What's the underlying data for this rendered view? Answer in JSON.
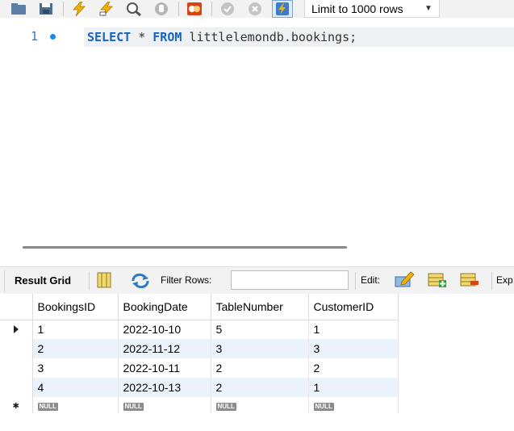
{
  "toolbar": {
    "icons": [
      "open-folder-icon",
      "save-icon",
      "execute-icon",
      "execute-current-icon",
      "explain-icon",
      "stop-icon",
      "toggle-error-icon",
      "commit-icon",
      "rollback-icon",
      "autocommit-icon"
    ],
    "limit_select": "Limit to 1000 rows"
  },
  "editor": {
    "line_number": "1",
    "code": {
      "select_kw": "SELECT",
      "star": " * ",
      "from_kw": "FROM",
      "rest": " littlelemondb.bookings;"
    }
  },
  "result": {
    "tab_label": "Result Grid",
    "filter_label": "Filter Rows:",
    "filter_value": "",
    "edit_label": "Edit:",
    "export_label": "Exp"
  },
  "grid": {
    "columns": [
      "BookingsID",
      "BookingDate",
      "TableNumber",
      "CustomerID"
    ],
    "rows": [
      [
        "1",
        "2022-10-10",
        "5",
        "1"
      ],
      [
        "2",
        "2022-11-12",
        "3",
        "3"
      ],
      [
        "3",
        "2022-10-11",
        "2",
        "2"
      ],
      [
        "4",
        "2022-10-13",
        "2",
        "1"
      ]
    ],
    "null_text": "NULL"
  },
  "colors": {
    "keyword": "#1565c0",
    "row_alt": "#eaf2fc",
    "line_highlight": "#eef0f3"
  }
}
